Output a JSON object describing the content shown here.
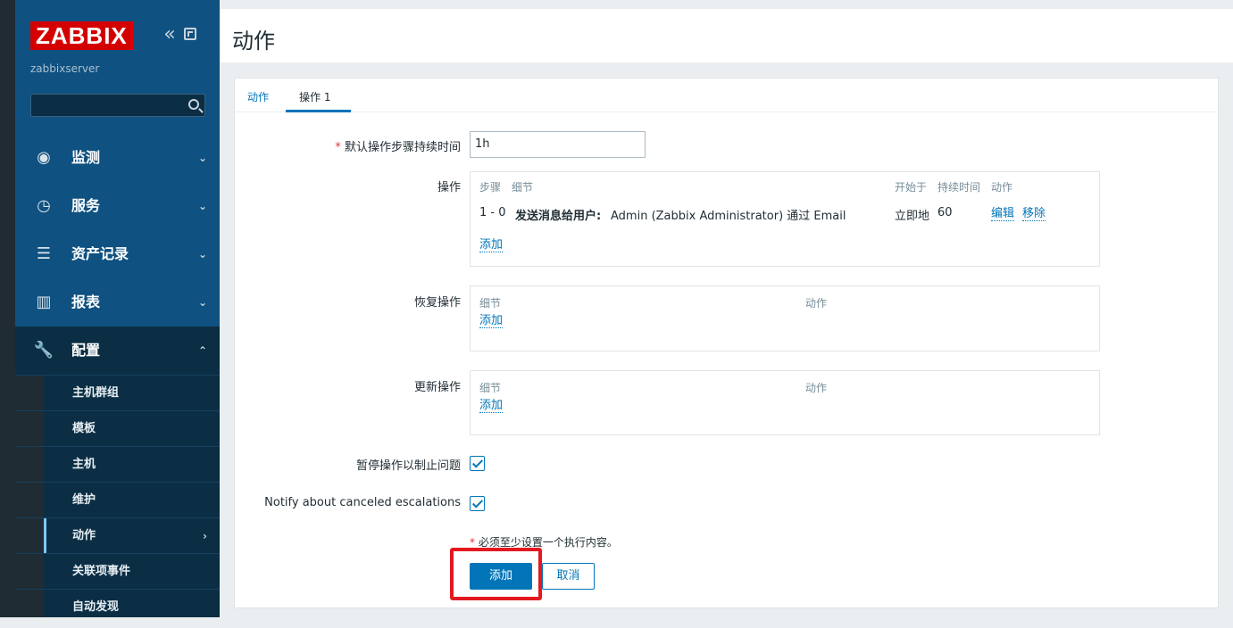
{
  "app": {
    "logo": "ZABBIX",
    "server": "zabbixserver",
    "collapse_glyph": "«"
  },
  "sidebar": {
    "items": [
      {
        "label": "监测",
        "icon": "eye-icon",
        "glyph": "◉",
        "chevron": "⌄"
      },
      {
        "label": "服务",
        "icon": "clock-icon",
        "glyph": "◷",
        "chevron": "⌄"
      },
      {
        "label": "资产记录",
        "icon": "list-icon",
        "glyph": "☰",
        "chevron": "⌄"
      },
      {
        "label": "报表",
        "icon": "bar-chart-icon",
        "glyph": "▥",
        "chevron": "⌄"
      },
      {
        "label": "配置",
        "icon": "wrench-icon",
        "glyph": "🔧",
        "chevron": "⌃"
      }
    ],
    "config_submenu": [
      {
        "label": "主机群组"
      },
      {
        "label": "模板"
      },
      {
        "label": "主机"
      },
      {
        "label": "维护"
      },
      {
        "label": "动作",
        "chevron": "›"
      },
      {
        "label": "关联项事件"
      },
      {
        "label": "自动发现"
      }
    ]
  },
  "page": {
    "title": "动作"
  },
  "tabs": [
    {
      "label": "动作"
    },
    {
      "label": "操作 1"
    }
  ],
  "form": {
    "default_step_duration": {
      "label": "默认操作步骤持续时间",
      "required": "*",
      "value": "1h"
    },
    "operations": {
      "label": "操作",
      "headers": {
        "step": "步骤",
        "details": "细节",
        "start_in": "开始于",
        "duration": "持续时间",
        "action": "动作"
      },
      "rows": [
        {
          "step": "1 - 0",
          "details_bold": "发送消息给用户:",
          "details_rest": "Admin (Zabbix Administrator) 通过 Email",
          "start_in": "立即地",
          "duration": "60",
          "edit": "编辑",
          "remove": "移除"
        }
      ],
      "add": "添加"
    },
    "recovery_operations": {
      "label": "恢复操作",
      "headers": {
        "details": "细节",
        "action": "动作"
      },
      "add": "添加"
    },
    "update_operations": {
      "label": "更新操作",
      "headers": {
        "details": "细节",
        "action": "动作"
      },
      "add": "添加"
    },
    "pause_suppressed": {
      "label": "暂停操作以制止问题",
      "checked": true
    },
    "notify_canceled": {
      "label": "Notify about canceled escalations",
      "checked": true
    },
    "required_note": {
      "marker": "*",
      "text": "必须至少设置一个执行内容。"
    },
    "buttons": {
      "add": "添加",
      "cancel": "取消"
    }
  },
  "colors": {
    "sidebar_bg": "#0f5180",
    "accent": "#0275b8",
    "logo_red": "#d40000",
    "highlight_red": "#e3191f"
  }
}
